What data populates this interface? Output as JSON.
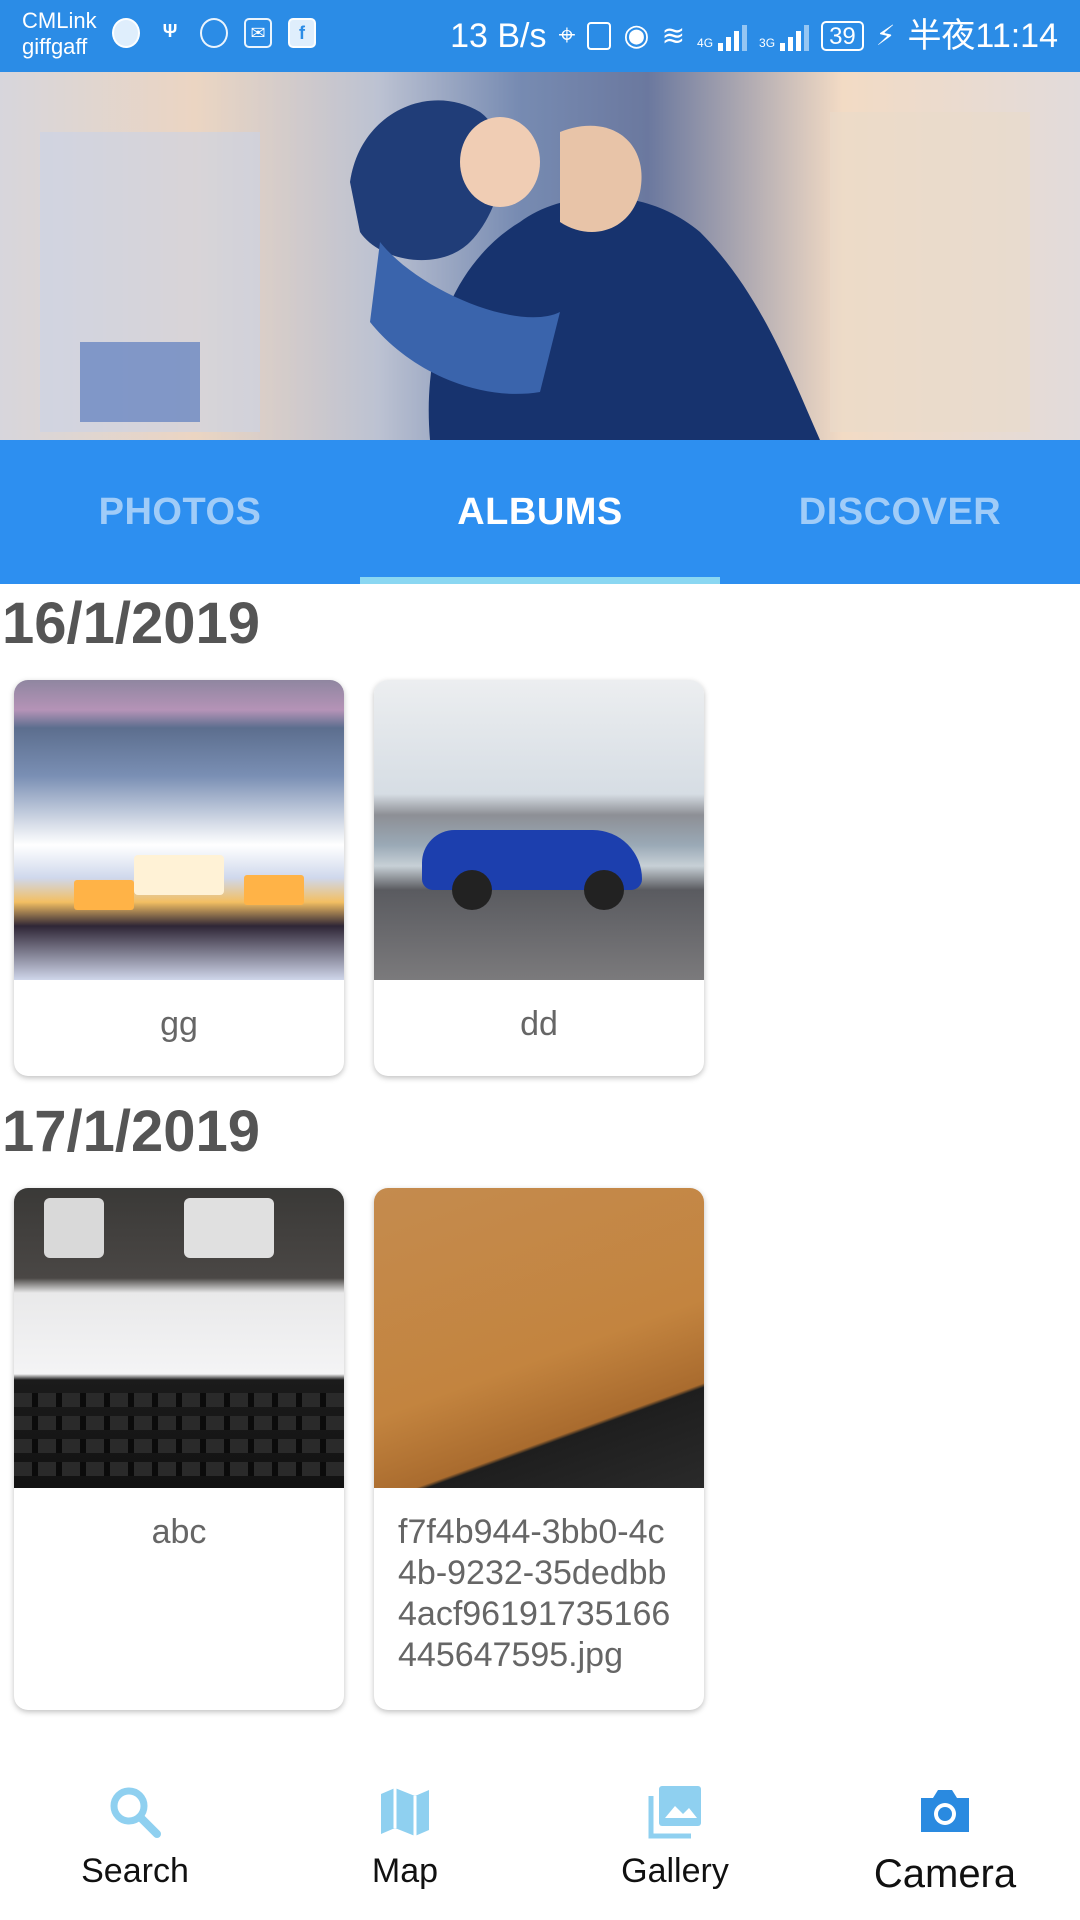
{
  "status_bar": {
    "carrier_line1": "CMLink",
    "carrier_line2": "giffgaff",
    "net_speed": "13 B/s",
    "signal1_type": "4G",
    "signal2_type": "3G",
    "battery": "39",
    "time": "半夜11:14",
    "icons": [
      "shield-icon",
      "usb-icon",
      "browser-icon",
      "mail-icon",
      "facebook-icon",
      "location-icon",
      "vibrate-icon",
      "eye-icon",
      "wifi-icon",
      "signal-icon",
      "charging-icon"
    ]
  },
  "tabs": [
    {
      "label": "PHOTOS",
      "active": false
    },
    {
      "label": "ALBUMS",
      "active": true
    },
    {
      "label": "DISCOVER",
      "active": false
    }
  ],
  "sections": [
    {
      "date": "16/1/2019",
      "albums": [
        {
          "name": "gg",
          "thumb": "snowy-village"
        },
        {
          "name": "dd",
          "thumb": "blue-car"
        }
      ]
    },
    {
      "date": "17/1/2019",
      "albums": [
        {
          "name": "abc",
          "thumb": "desk-keyboard"
        },
        {
          "name": "f7f4b944-3bb0-4c4b-9232-35dedbb4acf96191735166445647595.jpg",
          "thumb": "orange-surface"
        }
      ]
    }
  ],
  "bottom_nav": [
    {
      "label": "Search",
      "icon": "search-icon",
      "active": false
    },
    {
      "label": "Map",
      "icon": "map-icon",
      "active": false
    },
    {
      "label": "Gallery",
      "icon": "gallery-icon",
      "active": false
    },
    {
      "label": "Camera",
      "icon": "camera-icon",
      "active": true
    }
  ],
  "colors": {
    "primary": "#2d8ff0",
    "tab_indicator": "#8ad7f2",
    "nav_icon_inactive": "#8fd0f0",
    "nav_icon_active": "#2a8ae0"
  }
}
